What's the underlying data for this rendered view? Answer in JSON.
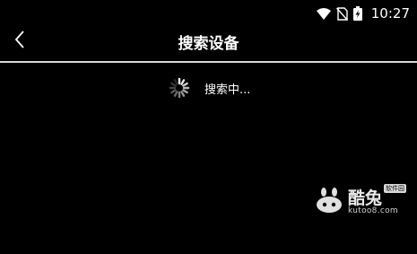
{
  "status_bar": {
    "time": "10:27",
    "icons": [
      "wifi-icon",
      "no-sim-icon",
      "battery-charging-icon"
    ]
  },
  "header": {
    "title": "搜索设备",
    "back_icon": "chevron-left-icon"
  },
  "main": {
    "searching_text": "搜索中...",
    "spinner_icon": "loading-spinner-icon"
  },
  "watermark": {
    "name": "酷兔",
    "badge": "软件园",
    "url": "kutoo8.com"
  },
  "colors": {
    "background": "#000000",
    "text": "#ffffff",
    "divider": "#d8d8d8"
  }
}
